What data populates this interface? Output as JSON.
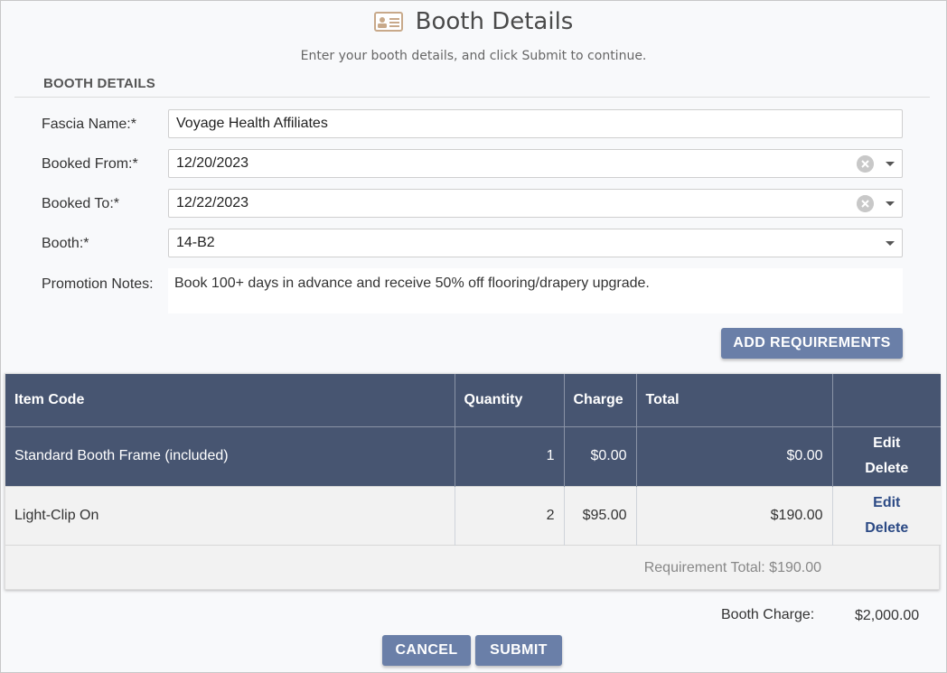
{
  "header": {
    "title": "Booth Details",
    "icon": "id-card-icon",
    "subtitle": "Enter your booth details, and click Submit to continue."
  },
  "section": {
    "title": "BOOTH DETAILS"
  },
  "form": {
    "fascia_label": "Fascia Name:*",
    "fascia_value": "Voyage Health Affiliates",
    "from_label": "Booked From:*",
    "from_value": "12/20/2023",
    "to_label": "Booked To:*",
    "to_value": "12/22/2023",
    "booth_label": "Booth:*",
    "booth_value": "14-B2",
    "notes_label": "Promotion Notes:",
    "notes_value": "Book 100+ days in advance and receive 50% off flooring/drapery upgrade."
  },
  "add_requirements_label": "ADD REQUIREMENTS",
  "table": {
    "columns": [
      "Item Code",
      "Quantity",
      "Charge",
      "Total",
      ""
    ],
    "rows": [
      {
        "item": "Standard Booth Frame (included)",
        "quantity": "1",
        "charge": "$0.00",
        "total": "$0.00",
        "edit": "Edit",
        "delete": "Delete"
      },
      {
        "item": "Light-Clip On",
        "quantity": "2",
        "charge": "$95.00",
        "total": "$190.00",
        "edit": "Edit",
        "delete": "Delete"
      }
    ],
    "requirement_total": "Requirement Total: $190.00"
  },
  "booth_charge": {
    "label": "Booth Charge:",
    "value": "$2,000.00"
  },
  "buttons": {
    "cancel": "CANCEL",
    "submit": "SUBMIT"
  },
  "colors": {
    "header_bg": "#475571",
    "button_bg": "#6a7fa8",
    "link": "#2c4a85",
    "icon": "#c8a98a"
  }
}
